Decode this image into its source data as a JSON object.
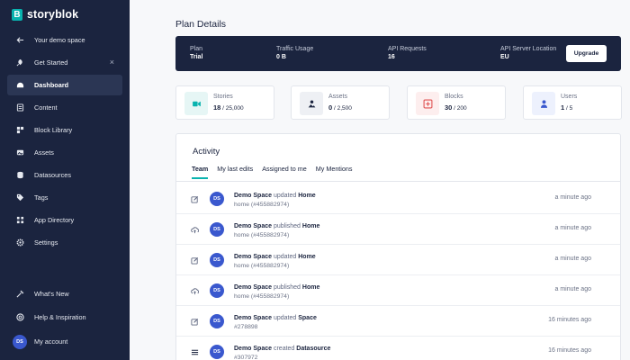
{
  "brand": {
    "name": "storyblok",
    "mark": "B"
  },
  "sidebar": {
    "items": [
      {
        "label": "Your demo space",
        "icon": "arrow-left-icon"
      },
      {
        "label": "Get Started",
        "icon": "rocket-icon",
        "close": "×"
      },
      {
        "label": "Dashboard",
        "icon": "dashboard-icon",
        "active": true
      },
      {
        "label": "Content",
        "icon": "content-icon"
      },
      {
        "label": "Block Library",
        "icon": "block-library-icon"
      },
      {
        "label": "Assets",
        "icon": "assets-icon"
      },
      {
        "label": "Datasources",
        "icon": "datasources-icon"
      },
      {
        "label": "Tags",
        "icon": "tags-icon"
      },
      {
        "label": "App Directory",
        "icon": "app-directory-icon"
      },
      {
        "label": "Settings",
        "icon": "settings-icon"
      },
      {
        "label": "What's New",
        "icon": "whats-new-icon"
      },
      {
        "label": "Help & Inspiration",
        "icon": "help-icon"
      },
      {
        "label": "My account",
        "avatar": "DS"
      }
    ]
  },
  "page": {
    "title": "Plan Details"
  },
  "plan": {
    "plan_label": "Plan",
    "plan_value": "Trial",
    "traffic_label": "Traffic Usage",
    "traffic_value": "0 B",
    "api_label": "API Requests",
    "api_value": "16",
    "location_label": "API Server Location",
    "location_value": "EU",
    "upgrade_label": "Upgrade"
  },
  "stats": [
    {
      "label": "Stories",
      "value": "18",
      "total": " / 25,000",
      "color": "#e6f6f5",
      "icon": "stories-icon"
    },
    {
      "label": "Assets",
      "value": "0",
      "total": " / 2,500",
      "color": "#eef0f4",
      "icon": "assets-icon"
    },
    {
      "label": "Blocks",
      "value": "30",
      "total": " / 200",
      "color": "#fdeeee",
      "icon": "blocks-icon"
    },
    {
      "label": "Users",
      "value": "1",
      "total": " / 5",
      "color": "#edf1fd",
      "icon": "users-icon"
    }
  ],
  "activity": {
    "title": "Activity",
    "tabs": [
      "Team",
      "My last edits",
      "Assigned to me",
      "My Mentions"
    ],
    "rows": [
      {
        "icon": "edit-icon",
        "avatar": "DS",
        "actor": "Demo Space",
        "verb": " updated ",
        "target": "Home",
        "sub": "home (#455882974)",
        "time": "a minute ago"
      },
      {
        "icon": "publish-icon",
        "avatar": "DS",
        "actor": "Demo Space",
        "verb": " published ",
        "target": "Home",
        "sub": "home (#455882974)",
        "time": "a minute ago"
      },
      {
        "icon": "edit-icon",
        "avatar": "DS",
        "actor": "Demo Space",
        "verb": " updated ",
        "target": "Home",
        "sub": "home (#455882974)",
        "time": "a minute ago"
      },
      {
        "icon": "publish-icon",
        "avatar": "DS",
        "actor": "Demo Space",
        "verb": " published ",
        "target": "Home",
        "sub": "home (#455882974)",
        "time": "a minute ago"
      },
      {
        "icon": "edit-icon",
        "avatar": "DS",
        "actor": "Demo Space",
        "verb": " updated ",
        "target": "Space",
        "sub": "#278898",
        "time": "16 minutes ago"
      },
      {
        "icon": "datasource-icon",
        "avatar": "DS",
        "actor": "Demo Space",
        "verb": " created ",
        "target": "Datasource",
        "sub": "#307972",
        "time": "16 minutes ago"
      }
    ]
  }
}
